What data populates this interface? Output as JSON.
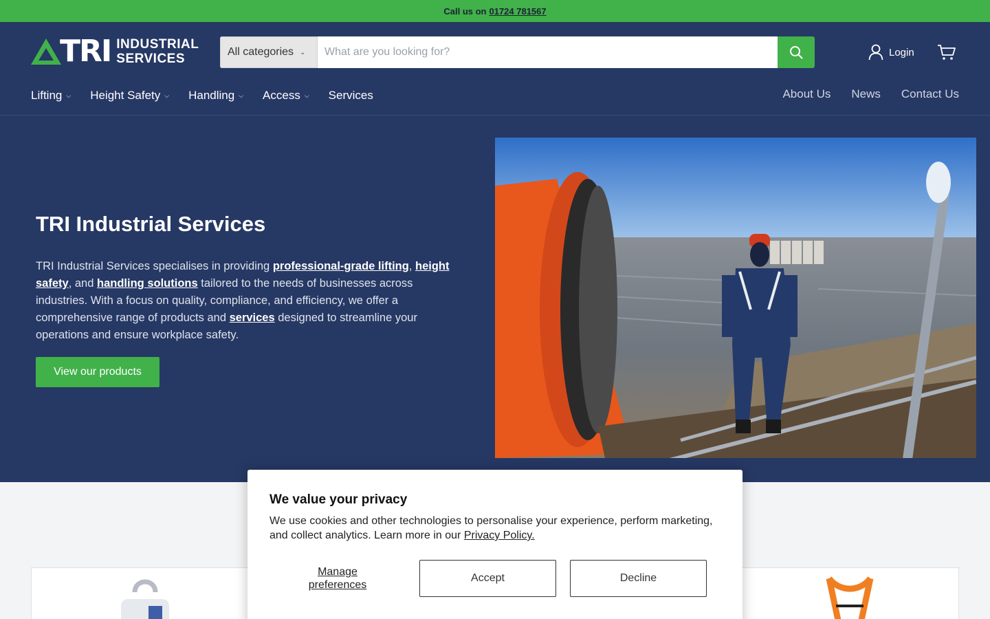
{
  "topbar": {
    "call_label": "Call us on",
    "phone": "01724 781567"
  },
  "logo": {
    "main": "TRI",
    "line1": "INDUSTRIAL",
    "line2": "SERVICES"
  },
  "search": {
    "category": "All categories",
    "placeholder": "What are you looking for?"
  },
  "account": {
    "login_label": "Login"
  },
  "nav": {
    "items": [
      {
        "label": "Lifting"
      },
      {
        "label": "Height Safety"
      },
      {
        "label": "Handling"
      },
      {
        "label": "Access"
      },
      {
        "label": "Services"
      }
    ],
    "secondary": [
      "About Us",
      "News",
      "Contact Us"
    ]
  },
  "hero": {
    "title": "TRI Industrial Services",
    "text_1": "TRI Industrial Services specialises in providing ",
    "link_lifting": "professional-grade lifting",
    "text_2": ", ",
    "link_height": "height safety",
    "text_3": ", and ",
    "link_handling": "handling solutions",
    "text_4": " tailored to the needs of businesses across industries. With a focus on quality, compliance, and efficiency, we offer a comprehensive range of products and ",
    "link_services": "services",
    "text_5": " designed to streamline your operations and ensure workplace safety.",
    "cta": "View our products"
  },
  "cookie": {
    "title": "We value your privacy",
    "text": "We use cookies and other technologies to personalise your experience, perform marketing, and collect analytics. Learn more in our ",
    "policy_link": "Privacy Policy.",
    "manage": "Manage preferences",
    "accept": "Accept",
    "decline": "Decline"
  },
  "colors": {
    "brand_green": "#41b14a",
    "navy": "#263864"
  }
}
